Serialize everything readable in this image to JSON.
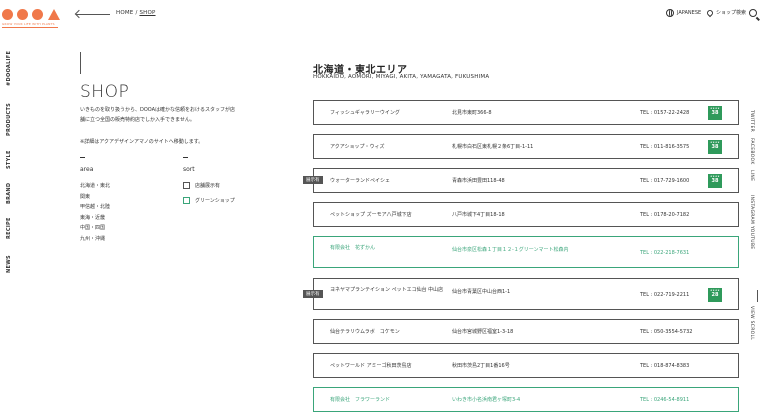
{
  "header": {
    "logo_text": "DOOA",
    "logo_tagline": "GROW YOUR LIFE WITH PLANTS",
    "breadcrumb_home": "HOME",
    "breadcrumb_sep": " / ",
    "breadcrumb_current": "SHOP",
    "lang_label": "JAPANESE",
    "shop_search_label": "ショップ検索"
  },
  "left_nav": [
    "#DOOALIFE",
    "PRODUCTS",
    "STYLE",
    "BRAND",
    "RECIPE",
    "NEWS"
  ],
  "right_nav": [
    "TWITTER",
    "FACEBOOK",
    "LINE",
    "INSTAGRAM",
    "YOUTUBE",
    "VIEW SCROLL"
  ],
  "shop_page": {
    "title": "SHOP",
    "description": "いきものを取り扱うから、DOOAは確かな信頼をおけるスタッフが店舗に立つ全国の販売特約店でしか入手できません。",
    "note": "※詳細はアクアデザインアマノのサイトへ移動します。",
    "area_label": "area",
    "sort_label": "sort",
    "areas": [
      "北海道・東北",
      "関東",
      "甲信越・北陸",
      "東海・近畿",
      "中国・四国",
      "九州・沖縄"
    ],
    "sort_options": [
      "店舗展示有",
      "グリーンショップ"
    ]
  },
  "region": {
    "title": "北海道・東北エリア",
    "subtitle": "HOKKAIDO, AOMORI, MIYAGI, AKITA, YAMAGATA, FUKUSHIMA"
  },
  "shops": [
    {
      "name": "フィッシュギャラリーウイング",
      "address": "北見市東町366-8",
      "tel": "TEL : 0157-22-2428",
      "badge": "38",
      "display": "",
      "green": false
    },
    {
      "name": "アクアショップ・ウィズ",
      "address": "札幌市白石区東札幌２条6丁目-1-11",
      "tel": "TEL : 011-816-3575",
      "badge": "38",
      "display": "",
      "green": false
    },
    {
      "name": "ウォーターランドペイシェ",
      "address": "青森市浜田豊田118-48",
      "tel": "TEL : 017-729-1600",
      "badge": "38",
      "display": "展示有",
      "green": false
    },
    {
      "name": "ペットショップ ズーモア八戸城下店",
      "address": "八戸市城下4丁目18-18",
      "tel": "TEL : 0178-20-7182",
      "badge": "",
      "display": "",
      "green": false
    },
    {
      "name": "有限会社　花ずかん",
      "address": "仙台市泉区松森１丁目１２-１グリーンマート松森内",
      "tel": "TEL : 022-218-7631",
      "badge": "",
      "display": "",
      "green": true
    },
    {
      "name": "ヨネヤマプランテイション ペットエコ仙台 中山店",
      "address": "仙台市青葉区中山台西1-1",
      "tel": "TEL : 022-719-2211",
      "badge": "28",
      "display": "展示有",
      "green": false
    },
    {
      "name": "仙台テラリウムラボ　コケモン",
      "address": "仙台市宮城野区福室1-3-18",
      "tel": "TEL : 050-3554-5732",
      "badge": "",
      "display": "",
      "green": false
    },
    {
      "name": "ペットワールド アミーゴ秋田茨島店",
      "address": "秋田市茨島2丁目1番16号",
      "tel": "TEL : 018-874-8383",
      "badge": "",
      "display": "",
      "green": false
    },
    {
      "name": "有限会社　フラワーランド",
      "address": "いわき市小名浜南君ヶ塚町3-4",
      "tel": "TEL : 0246-54-8911",
      "badge": "",
      "display": "",
      "green": true
    }
  ],
  "colors": {
    "accent": "#f0784a",
    "green": "#3aa57a",
    "badge_green": "#2f9a5b"
  }
}
